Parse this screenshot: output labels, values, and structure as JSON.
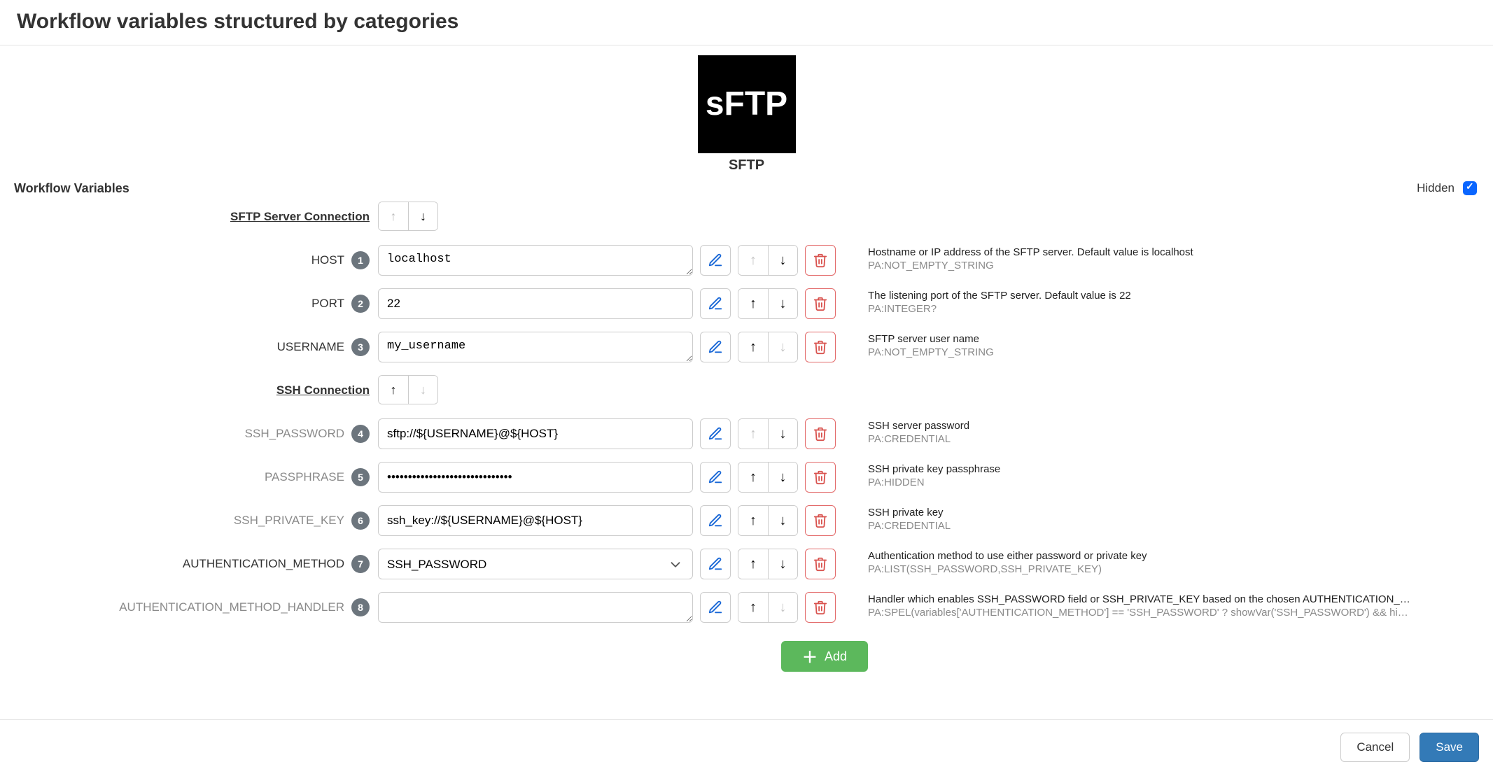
{
  "title": "Workflow variables structured by categories",
  "logo_text": "sFTP",
  "logo_caption": "SFTP",
  "section_label": "Workflow Variables",
  "hidden_label": "Hidden",
  "hidden_checked": true,
  "add_label": "Add",
  "cancel_label": "Cancel",
  "save_label": "Save",
  "groups": [
    {
      "name": "SFTP Server Connection",
      "up_disabled": true,
      "down_disabled": false,
      "vars": [
        {
          "idx": "1",
          "label": "HOST",
          "dim": false,
          "input_type": "textarea",
          "value": "localhost",
          "up_disabled": true,
          "down_disabled": false,
          "desc": "Hostname or IP address of the SFTP server. Default value is localhost",
          "meta": "PA:NOT_EMPTY_STRING"
        },
        {
          "idx": "2",
          "label": "PORT",
          "dim": false,
          "input_type": "text",
          "value": "22",
          "up_disabled": false,
          "down_disabled": false,
          "desc": "The listening port of the SFTP server. Default value is 22",
          "meta": "PA:INTEGER?"
        },
        {
          "idx": "3",
          "label": "USERNAME",
          "dim": false,
          "input_type": "textarea",
          "value": "my_username",
          "up_disabled": false,
          "down_disabled": true,
          "desc": "SFTP server user name",
          "meta": "PA:NOT_EMPTY_STRING"
        }
      ]
    },
    {
      "name": "SSH Connection",
      "up_disabled": false,
      "down_disabled": true,
      "vars": [
        {
          "idx": "4",
          "label": "SSH_PASSWORD",
          "dim": true,
          "input_type": "text",
          "value": "sftp://${USERNAME}@${HOST}",
          "up_disabled": true,
          "down_disabled": false,
          "desc": "SSH server password",
          "meta": "PA:CREDENTIAL"
        },
        {
          "idx": "5",
          "label": "PASSPHRASE",
          "dim": true,
          "input_type": "password",
          "value": "••••••••••••••••••••••••••••••",
          "up_disabled": false,
          "down_disabled": false,
          "desc": "SSH private key passphrase",
          "meta": "PA:HIDDEN"
        },
        {
          "idx": "6",
          "label": "SSH_PRIVATE_KEY",
          "dim": true,
          "input_type": "text",
          "value": "ssh_key://${USERNAME}@${HOST}",
          "up_disabled": false,
          "down_disabled": false,
          "desc": "SSH private key",
          "meta": "PA:CREDENTIAL"
        },
        {
          "idx": "7",
          "label": "AUTHENTICATION_METHOD",
          "dim": false,
          "input_type": "select",
          "value": "SSH_PASSWORD",
          "up_disabled": false,
          "down_disabled": false,
          "desc": "Authentication method to use either password or private key",
          "meta": "PA:LIST(SSH_PASSWORD,SSH_PRIVATE_KEY)"
        },
        {
          "idx": "8",
          "label": "AUTHENTICATION_METHOD_HANDLER",
          "dim": true,
          "input_type": "textarea",
          "value": "",
          "up_disabled": false,
          "down_disabled": true,
          "desc": "Handler which enables SSH_PASSWORD field or SSH_PRIVATE_KEY based on the chosen AUTHENTICATION_…",
          "meta": "PA:SPEL(variables['AUTHENTICATION_METHOD'] == 'SSH_PASSWORD' ? showVar('SSH_PASSWORD') && hi…"
        }
      ]
    }
  ]
}
